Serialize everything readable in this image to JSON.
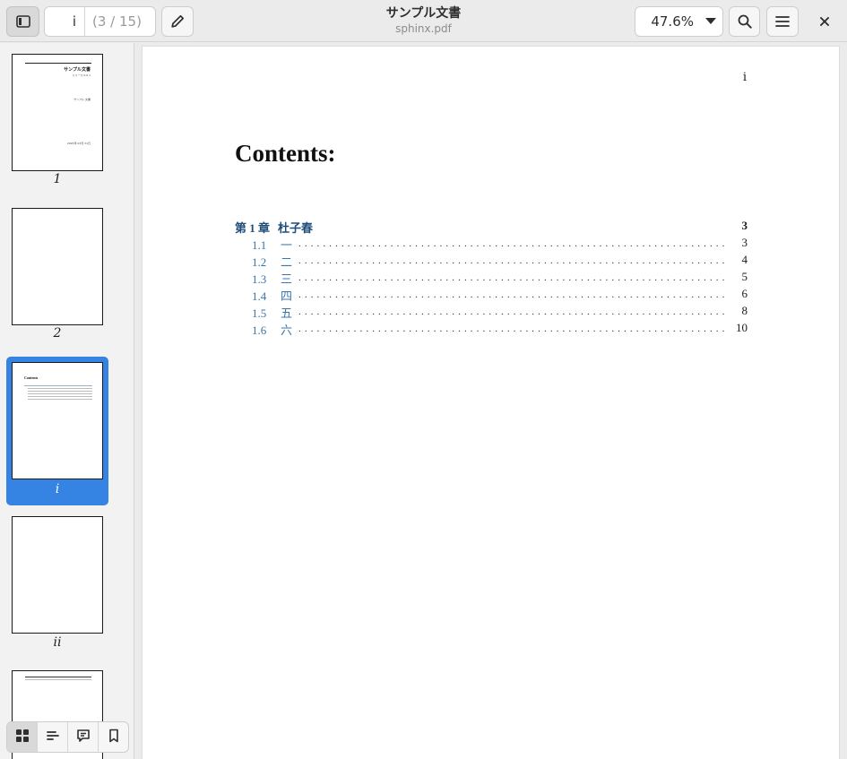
{
  "header": {
    "page_current": "i",
    "page_total": "(3 / 15)",
    "title": "サンプル文書",
    "subtitle": "sphinx.pdf",
    "zoom": "47.6%"
  },
  "sidebar": {
    "thumbnails": [
      {
        "label": "1",
        "selected": false,
        "thumb_text": [
          "サンプル文書",
          "リリース 0.0.1",
          "サンプル 文書",
          "2025年 03月 31日"
        ]
      },
      {
        "label": "2",
        "selected": false
      },
      {
        "label": "i",
        "selected": true,
        "thumb_text": [
          "Contents"
        ]
      },
      {
        "label": "ii",
        "selected": false
      },
      {
        "label": "",
        "selected": false
      }
    ],
    "tabs": [
      "thumbnails",
      "outline",
      "annotations",
      "bookmarks"
    ]
  },
  "page": {
    "number": "i",
    "heading": "Contents:",
    "toc": {
      "chapter": {
        "num": "第 1 章",
        "title": "杜子春",
        "page": "3"
      },
      "sections": [
        {
          "num": "1.1",
          "title": "一",
          "page": "3"
        },
        {
          "num": "1.2",
          "title": "二",
          "page": "4"
        },
        {
          "num": "1.3",
          "title": "三",
          "page": "5"
        },
        {
          "num": "1.4",
          "title": "四",
          "page": "6"
        },
        {
          "num": "1.5",
          "title": "五",
          "page": "8"
        },
        {
          "num": "1.6",
          "title": "六",
          "page": "10"
        }
      ]
    }
  },
  "colors": {
    "accent": "#3584e4",
    "link_chapter": "#1f4e79",
    "link_section": "#3a75ad"
  }
}
